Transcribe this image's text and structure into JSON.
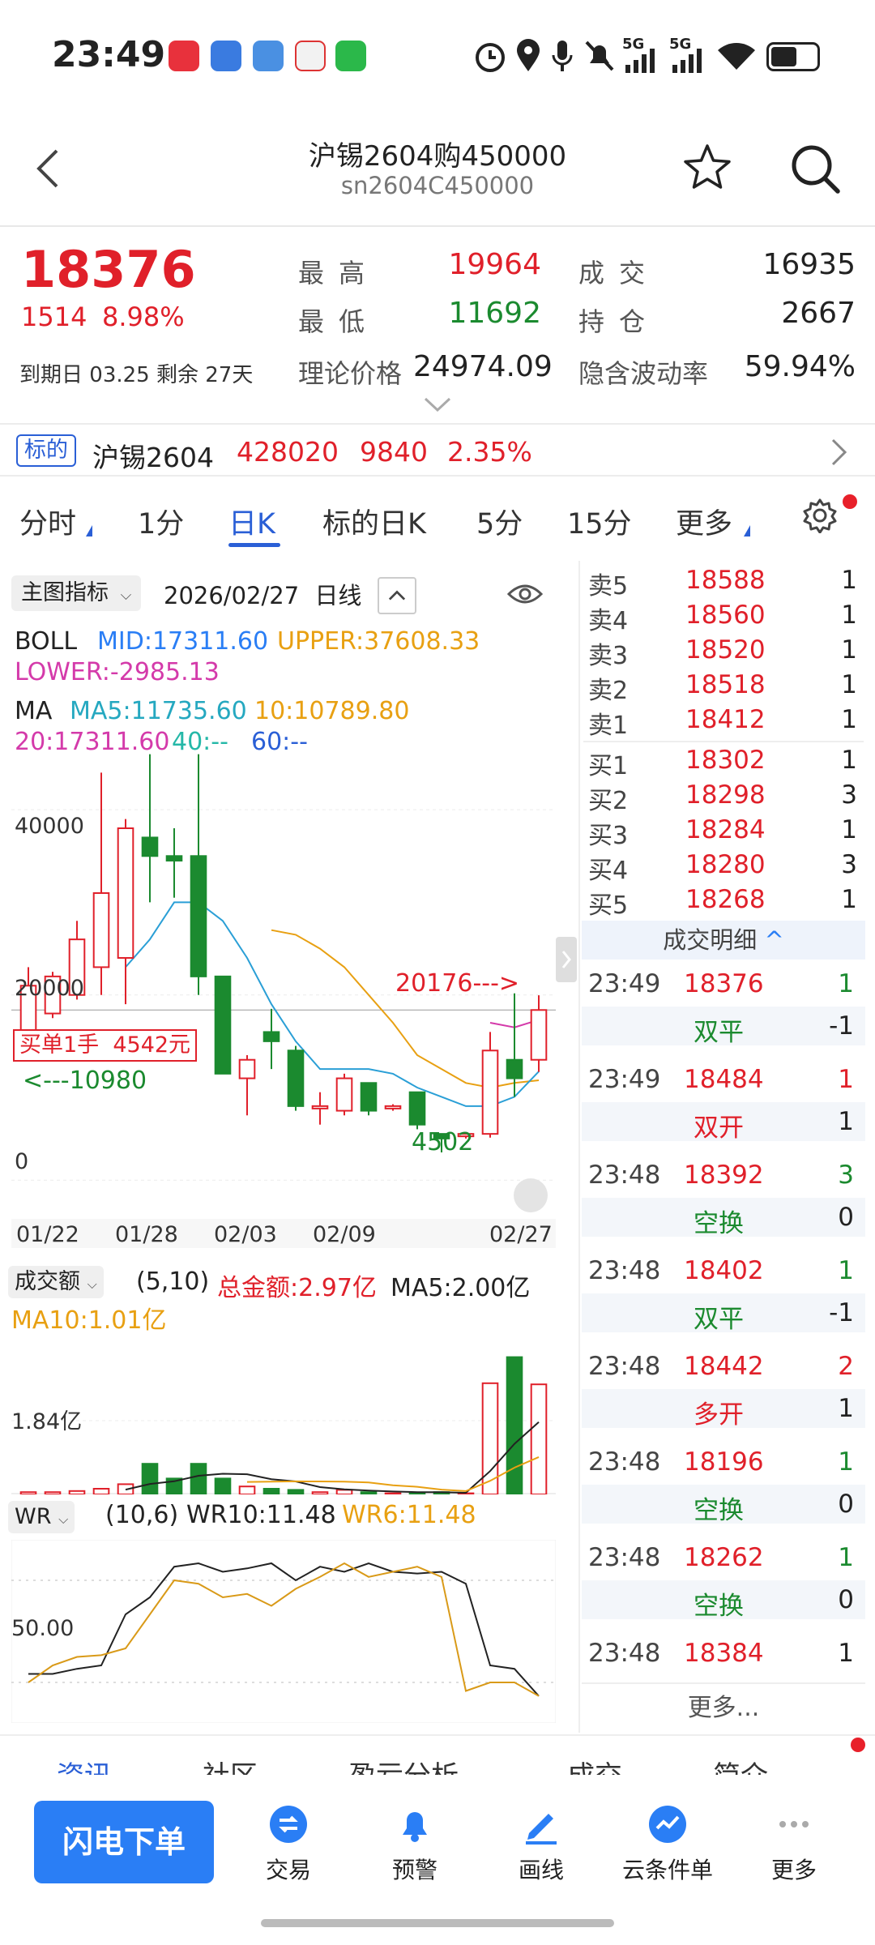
{
  "status_bar": {
    "time": "23:49",
    "net1": "5G",
    "net2": "5G",
    "battery_level": 0.55
  },
  "header": {
    "title": "沪锡2604购450000",
    "subtitle": "sn2604C450000"
  },
  "quote": {
    "price": "18376",
    "change": "1514",
    "change_pct": "8.98%",
    "high_label": "最高",
    "high": "19964",
    "low_label": "最低",
    "low": "11692",
    "volume_label": "成交",
    "volume": "16935",
    "oi_label": "持仓",
    "oi": "2667",
    "expiry_label": "到期日",
    "expiry": "03.25",
    "remain_label": "剩余",
    "remain": "27天",
    "theo_label": "理论价格",
    "theo": "24974.09",
    "iv_label": "隐含波动率",
    "iv": "59.94%"
  },
  "underlying": {
    "badge": "标的",
    "name": "沪锡2604",
    "price": "428020",
    "change": "9840",
    "pct": "2.35%"
  },
  "tabs": [
    "分时",
    "1分",
    "日K",
    "标的日K",
    "5分",
    "15分",
    "更多"
  ],
  "chart": {
    "indicator_select": "主图指标",
    "date": "2026/02/27",
    "period": "日线",
    "boll_name": "BOLL",
    "boll_mid": "MID:17311.60",
    "boll_upper": "UPPER:37608.33",
    "boll_lower": "LOWER:-2985.13",
    "ma_name": "MA",
    "ma5": "MA5:11735.60",
    "ma10": "10:10789.80",
    "ma20": "20:17311.60",
    "ma40": "40:--",
    "ma60": "60:--",
    "y_ticks": [
      "40000",
      "20000",
      "0"
    ],
    "x_ticks": [
      "01/22",
      "01/28",
      "02/03",
      "02/09",
      "02/27"
    ],
    "ann_high": "20176",
    "ann_low": "4502",
    "ann_left": "10980",
    "buy_label": "买单1手  4542元",
    "vol_select": "成交额",
    "vol_params": "(5,10)",
    "vol_total": "总金额:2.97亿",
    "vol_ma5": "MA5:2.00亿",
    "vol_ma10": "MA10:1.01亿",
    "vol_tick": "1.84亿",
    "wr_select": "WR",
    "wr_params": "(10,6)",
    "wr10": "WR10:11.48",
    "wr6": "WR6:11.48",
    "wr_tick": "50.00"
  },
  "chart_data": {
    "type": "candlestick",
    "y_range": [
      -4000,
      52000
    ],
    "candles": [
      {
        "o": 16000,
        "c": 21000,
        "h": 23000,
        "l": 16000
      },
      {
        "o": 18000,
        "c": 22000,
        "h": 22500,
        "l": 17500
      },
      {
        "o": 20000,
        "c": 26000,
        "h": 28000,
        "l": 19500
      },
      {
        "o": 23000,
        "c": 31000,
        "h": 44000,
        "l": 20000
      },
      {
        "o": 24000,
        "c": 38000,
        "h": 39000,
        "l": 19000
      },
      {
        "o": 37000,
        "c": 35000,
        "h": 46000,
        "l": 30000
      },
      {
        "o": 35000,
        "c": 34500,
        "h": 38000,
        "l": 30500
      },
      {
        "o": 35000,
        "c": 22000,
        "h": 46000,
        "l": 20000
      },
      {
        "o": 22000,
        "c": 11500,
        "h": 22000,
        "l": 11500
      },
      {
        "o": 11000,
        "c": 13000,
        "h": 13500,
        "l": 7000
      },
      {
        "o": 16000,
        "c": 15000,
        "h": 18500,
        "l": 12000
      },
      {
        "o": 14000,
        "c": 8000,
        "h": 14500,
        "l": 7500
      },
      {
        "o": 8000,
        "c": 8000,
        "h": 9500,
        "l": 6000
      },
      {
        "o": 7500,
        "c": 11000,
        "h": 11500,
        "l": 7000
      },
      {
        "o": 10500,
        "c": 7500,
        "h": 10500,
        "l": 7000
      },
      {
        "o": 8000,
        "c": 8000,
        "h": 8200,
        "l": 7500
      },
      {
        "o": 9500,
        "c": 6000,
        "h": 9500,
        "l": 5500
      },
      {
        "o": 5000,
        "c": 4500,
        "h": 5000,
        "l": 3000
      },
      {
        "o": 4800,
        "c": 5000,
        "h": 5200,
        "l": 4500
      },
      {
        "o": 5000,
        "c": 14000,
        "h": 16000,
        "l": 4600
      },
      {
        "o": 13000,
        "c": 11000,
        "h": 20176,
        "l": 9000
      },
      {
        "o": 13000,
        "c": 18376,
        "h": 19964,
        "l": 11692
      }
    ],
    "ma5": [
      null,
      null,
      null,
      null,
      23000,
      26000,
      30000,
      30000,
      28000,
      24000,
      19000,
      15000,
      12000,
      12000,
      12000,
      11500,
      10000,
      9000,
      8000,
      8000,
      9000,
      11735.6
    ],
    "ma10": [
      null,
      null,
      null,
      null,
      null,
      null,
      null,
      null,
      null,
      null,
      27000,
      26500,
      25000,
      23000,
      20000,
      17000,
      13500,
      12000,
      10500,
      10000,
      10500,
      10789.8
    ],
    "boll_mid_series": [
      null,
      null,
      null,
      null,
      null,
      null,
      null,
      null,
      null,
      null,
      null,
      null,
      null,
      null,
      null,
      null,
      null,
      null,
      null,
      17000,
      16500,
      17311.6
    ],
    "turnover": [
      0.02,
      0.02,
      0.03,
      0.05,
      0.09,
      0.27,
      0.14,
      0.27,
      0.14,
      0.07,
      0.05,
      0.04,
      0.02,
      0.04,
      0.02,
      0.01,
      0.01,
      0.02,
      0.01,
      0.98,
      1.21,
      0.97
    ],
    "wr10": [
      75,
      75,
      72,
      70,
      40,
      30,
      12,
      10,
      15,
      13,
      10,
      20,
      12,
      15,
      10,
      15,
      16,
      15,
      22,
      70,
      72,
      88
    ],
    "wr6": [
      80,
      70,
      65,
      64,
      60,
      40,
      20,
      22,
      30,
      28,
      35,
      25,
      18,
      10,
      18,
      15,
      12,
      18,
      85,
      80,
      80,
      88
    ]
  },
  "order_book": {
    "asks": [
      {
        "label": "卖5",
        "price": "18588",
        "vol": "1"
      },
      {
        "label": "卖4",
        "price": "18560",
        "vol": "1"
      },
      {
        "label": "卖3",
        "price": "18520",
        "vol": "1"
      },
      {
        "label": "卖2",
        "price": "18518",
        "vol": "1"
      },
      {
        "label": "卖1",
        "price": "18412",
        "vol": "1"
      }
    ],
    "bids": [
      {
        "label": "买1",
        "price": "18302",
        "vol": "1"
      },
      {
        "label": "买2",
        "price": "18298",
        "vol": "3"
      },
      {
        "label": "买3",
        "price": "18284",
        "vol": "1"
      },
      {
        "label": "买4",
        "price": "18280",
        "vol": "3"
      },
      {
        "label": "买5",
        "price": "18268",
        "vol": "1"
      }
    ],
    "trades_title": "成交明细",
    "trades": [
      {
        "time": "23:49",
        "price": "18376",
        "vol": "1",
        "vol_color": "#1b8a2f",
        "type": "双平",
        "type_color": "#1b8a2f",
        "oi": "-1"
      },
      {
        "time": "23:49",
        "price": "18484",
        "vol": "1",
        "vol_color": "#e0202a",
        "type": "双开",
        "type_color": "#e0202a",
        "oi": "1"
      },
      {
        "time": "23:48",
        "price": "18392",
        "vol": "3",
        "vol_color": "#1b8a2f",
        "type": "空换",
        "type_color": "#1b8a2f",
        "oi": "0"
      },
      {
        "time": "23:48",
        "price": "18402",
        "vol": "1",
        "vol_color": "#1b8a2f",
        "type": "双平",
        "type_color": "#1b8a2f",
        "oi": "-1"
      },
      {
        "time": "23:48",
        "price": "18442",
        "vol": "2",
        "vol_color": "#e0202a",
        "type": "多开",
        "type_color": "#e0202a",
        "oi": "1"
      },
      {
        "time": "23:48",
        "price": "18196",
        "vol": "1",
        "vol_color": "#1b8a2f",
        "type": "空换",
        "type_color": "#1b8a2f",
        "oi": "0"
      },
      {
        "time": "23:48",
        "price": "18262",
        "vol": "1",
        "vol_color": "#1b8a2f",
        "type": "空换",
        "type_color": "#1b8a2f",
        "oi": "0"
      },
      {
        "time": "23:48",
        "price": "18384",
        "vol": "1",
        "vol_color": "#222222",
        "type": "",
        "type_color": "#222222",
        "oi": ""
      }
    ],
    "more": "更多..."
  },
  "content_tabs": [
    "资讯",
    "社区",
    "盈亏分析",
    "成交",
    "简介"
  ],
  "bottom_nav": {
    "flash_order": "闪电下单",
    "items": [
      "交易",
      "预警",
      "画线",
      "云条件单",
      "更多"
    ]
  },
  "colors": {
    "up": "#e0202a",
    "down": "#1b8a2f",
    "accent": "#2a5fd6",
    "button": "#2a7ef5"
  }
}
